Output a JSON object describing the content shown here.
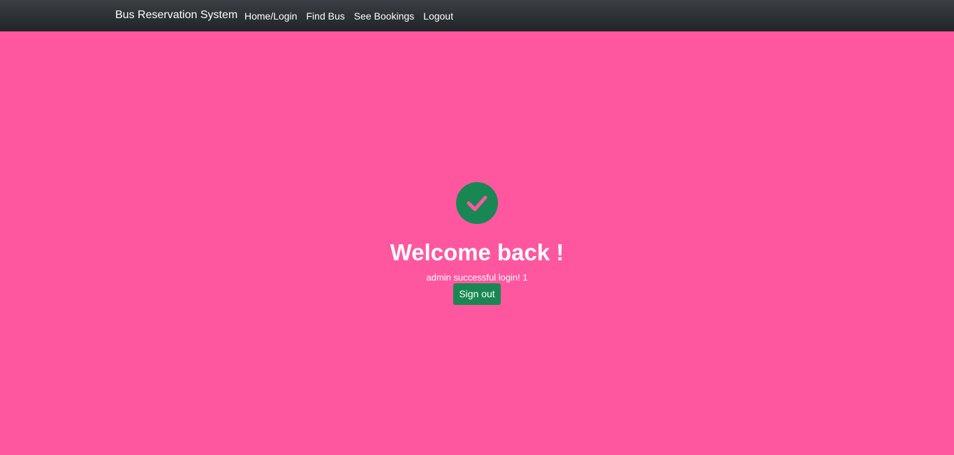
{
  "navbar": {
    "brand": "Bus Reservation System",
    "links": [
      {
        "label": "Home/Login"
      },
      {
        "label": "Find Bus"
      },
      {
        "label": "See Bookings"
      },
      {
        "label": "Logout"
      }
    ]
  },
  "main": {
    "status_icon": "check-circle-icon",
    "heading": "Welcome back !",
    "message": "admin successful login! 1",
    "signout_label": "Sign out"
  },
  "colors": {
    "page_background": "#ff579f",
    "navbar_background": "#212529",
    "success": "#198754",
    "text": "#ffffff"
  }
}
